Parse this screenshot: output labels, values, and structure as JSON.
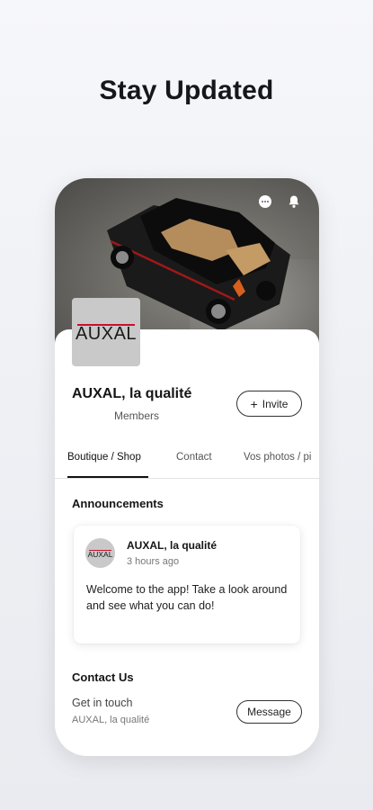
{
  "headline": "Stay Updated",
  "icons": {
    "chat": "chat-icon",
    "notifications": "bell-icon"
  },
  "hero": {
    "image": "black-car-photo"
  },
  "site": {
    "logo_text": "AUXAL",
    "title": "AUXAL, la qualité",
    "members_label": "Members",
    "invite_label": "Invite"
  },
  "tabs": [
    {
      "label": "Boutique / Shop",
      "active": true
    },
    {
      "label": "Contact",
      "active": false
    },
    {
      "label": "Vos photos / pi",
      "active": false
    }
  ],
  "announcements": {
    "heading": "Announcements",
    "post": {
      "avatar_text": "AUXAL",
      "author": "AUXAL, la qualité",
      "time": "3 hours ago",
      "body": "Welcome to the app! Take a look around and see what you can do!"
    }
  },
  "contact": {
    "heading": "Contact Us",
    "subtitle": "Get in touch",
    "site_name": "AUXAL, la qualité",
    "message_label": "Message"
  },
  "colors": {
    "accent_red": "#c8102e",
    "text_dark": "#151515"
  }
}
